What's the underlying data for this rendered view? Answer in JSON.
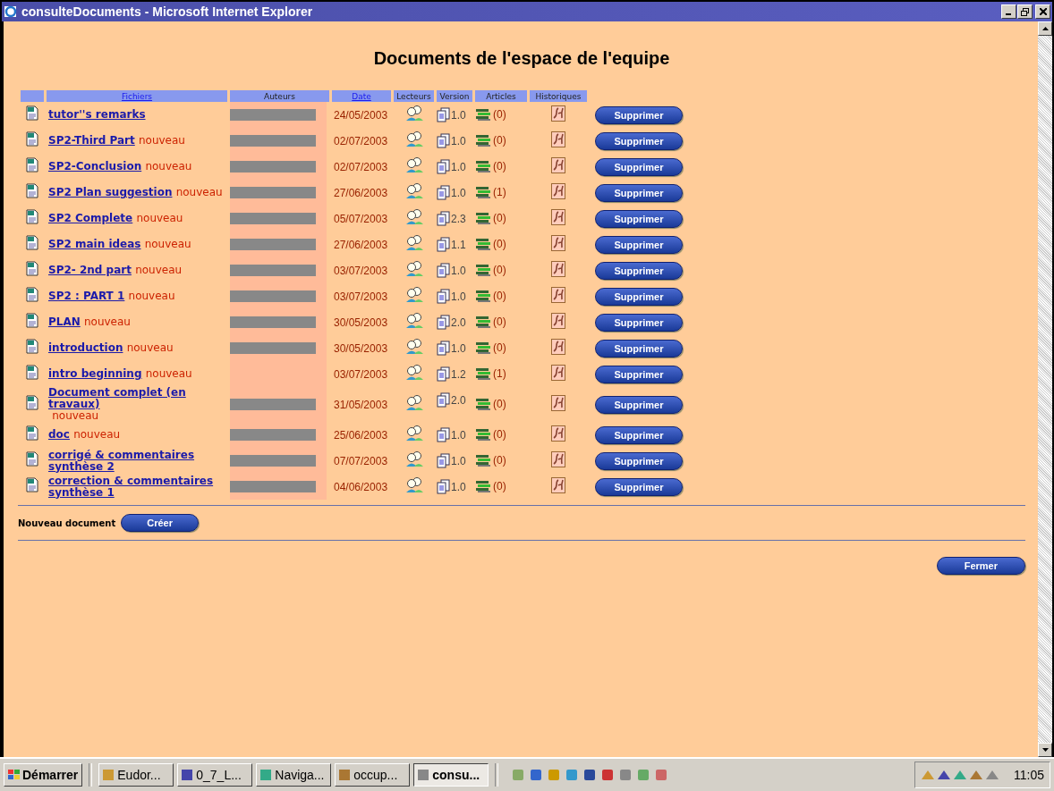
{
  "window": {
    "title": "consulteDocuments - Microsoft Internet Explorer"
  },
  "heading": "Documents de l'espace de l'equipe",
  "table": {
    "columns": [
      {
        "label": "Fichiers",
        "sortable": true
      },
      {
        "label": "Auteurs",
        "sortable": false
      },
      {
        "label": "Date",
        "sortable": true
      },
      {
        "label": "Lecteurs",
        "sortable": false
      },
      {
        "label": "Version",
        "sortable": false
      },
      {
        "label": "Articles",
        "sortable": false
      },
      {
        "label": "Historiques",
        "sortable": false
      }
    ],
    "rows": [
      {
        "file": "tutor''s remarks",
        "date": "24/05/2003",
        "version": "1.0",
        "articles": "(0)",
        "author_redacted": true,
        "delete": "Supprimer"
      },
      {
        "file": "SP2-Third Part",
        "badge": "nouveau",
        "date": "02/07/2003",
        "version": "1.0",
        "articles": "(0)",
        "author_redacted": true,
        "delete": "Supprimer"
      },
      {
        "file": "SP2-Conclusion",
        "badge": "nouveau",
        "date": "02/07/2003",
        "version": "1.0",
        "articles": "(0)",
        "author_redacted": true,
        "delete": "Supprimer"
      },
      {
        "file": "SP2  Plan  suggestion",
        "badge": "nouveau",
        "date": "27/06/2003",
        "version": "1.0",
        "articles": "(1)",
        "author_redacted": true,
        "delete": "Supprimer"
      },
      {
        "file": "SP2  Complete",
        "badge": "nouveau",
        "date": "05/07/2003",
        "version": "2.3",
        "articles": "(0)",
        "author_redacted": true,
        "delete": "Supprimer"
      },
      {
        "file": "SP2 main ideas",
        "badge": "nouveau",
        "date": "27/06/2003",
        "version": "1.1",
        "articles": "(0)",
        "author_redacted": true,
        "delete": "Supprimer"
      },
      {
        "file": "SP2- 2nd part",
        "badge": "nouveau",
        "date": "03/07/2003",
        "version": "1.0",
        "articles": "(0)",
        "author_redacted": true,
        "delete": "Supprimer"
      },
      {
        "file": "SP2 : PART 1",
        "badge": "nouveau",
        "date": "03/07/2003",
        "version": "1.0",
        "articles": "(0)",
        "author_redacted": true,
        "delete": "Supprimer"
      },
      {
        "file": "PLAN",
        "badge": "nouveau",
        "date": "30/05/2003",
        "version": "2.0",
        "articles": "(0)",
        "author_redacted": true,
        "delete": "Supprimer"
      },
      {
        "file": "introduction",
        "badge": "nouveau",
        "date": "30/05/2003",
        "version": "1.0",
        "articles": "(0)",
        "author_redacted": true,
        "delete": "Supprimer"
      },
      {
        "file": "intro beginning",
        "badge": "nouveau",
        "date": "03/07/2003",
        "version": "1.2",
        "articles": "(1)",
        "author_redacted": false,
        "delete": "Supprimer"
      },
      {
        "file": "Document complet (en travaux)",
        "badge": "nouveau",
        "date": "31/05/2003",
        "version": "2.0",
        "articles": "(0)",
        "author_redacted": true,
        "delete": "Supprimer"
      },
      {
        "file": "doc",
        "badge": "nouveau",
        "date": "25/06/2003",
        "version": "1.0",
        "articles": "(0)",
        "author_redacted": true,
        "delete": "Supprimer"
      },
      {
        "file": "corrigé & commentaires synthèse 2",
        "date": "07/07/2003",
        "version": "1.0",
        "articles": "(0)",
        "author_redacted": true,
        "delete": "Supprimer"
      },
      {
        "file": "correction & commentaires synthèse 1",
        "date": "04/06/2003",
        "version": "1.0",
        "articles": "(0)",
        "author_redacted": true,
        "delete": "Supprimer"
      }
    ]
  },
  "new_document": {
    "label": "Nouveau document",
    "button": "Créer"
  },
  "close_button": "Fermer",
  "taskbar": {
    "start": "Démarrer",
    "tasks": [
      {
        "label": "Eudor...",
        "selected": false
      },
      {
        "label": "0_7_L...",
        "selected": false
      },
      {
        "label": "Naviga...",
        "selected": false
      },
      {
        "label": "occup...",
        "selected": false
      },
      {
        "label": "consu...",
        "selected": true
      }
    ],
    "clock": "11:05"
  }
}
